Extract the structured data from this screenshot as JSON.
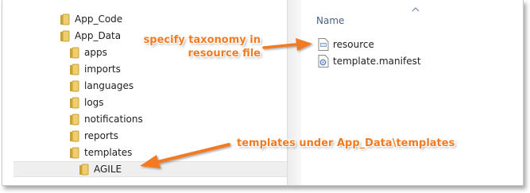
{
  "tree": {
    "items": [
      {
        "label": "App_Code"
      },
      {
        "label": "App_Data"
      },
      {
        "label": "apps"
      },
      {
        "label": "imports"
      },
      {
        "label": "languages"
      },
      {
        "label": "logs"
      },
      {
        "label": "notifications"
      },
      {
        "label": "reports"
      },
      {
        "label": "templates"
      },
      {
        "label": "AGILE"
      }
    ]
  },
  "files": {
    "column_header": "Name",
    "items": [
      {
        "label": "resource",
        "icon": "resource-file-icon"
      },
      {
        "label": "template.manifest",
        "icon": "manifest-file-icon"
      }
    ]
  },
  "callouts": {
    "resource_line1": "specify taxonomy in",
    "resource_line2": "resource file",
    "templates_text": "templates under App_Data\\templates"
  },
  "colors": {
    "callout": "#f47a20",
    "header_text": "#4d6082",
    "folder": "#e8c25a"
  }
}
